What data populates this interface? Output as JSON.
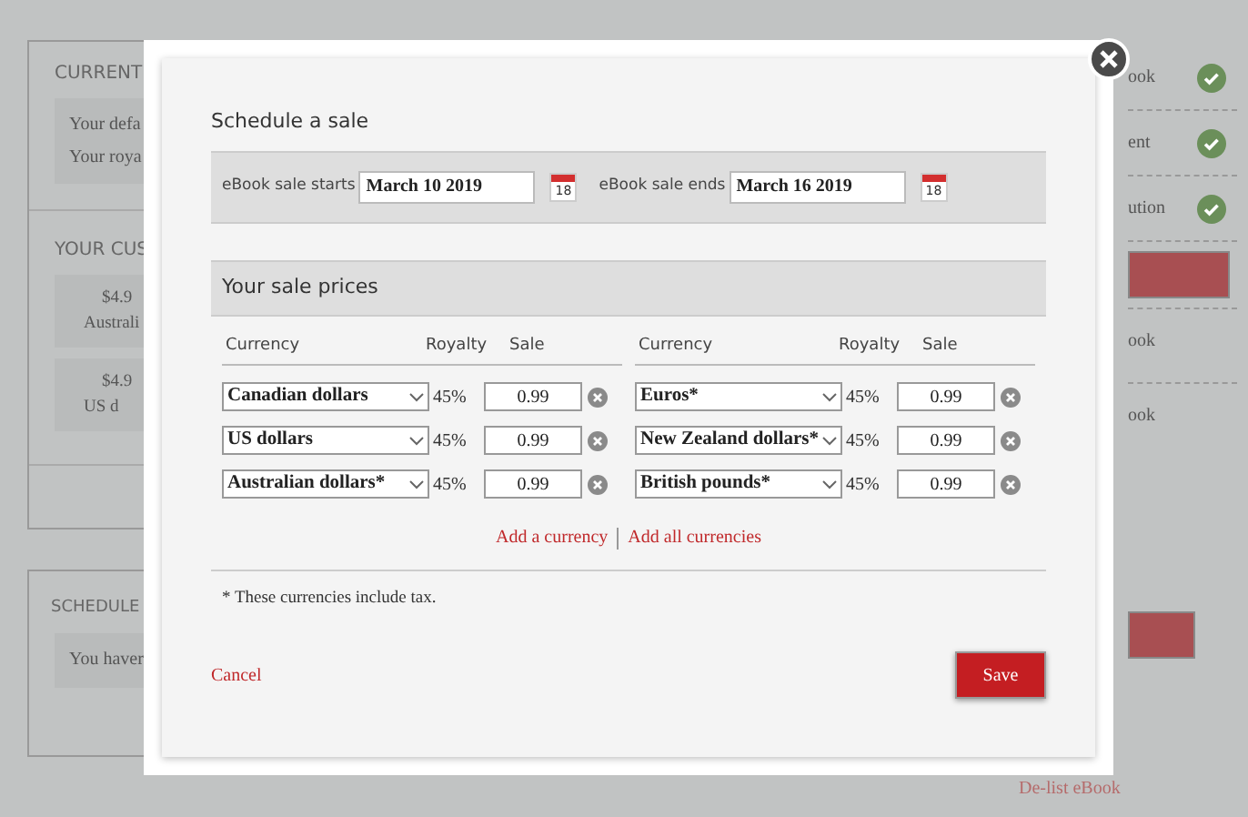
{
  "background": {
    "left_sections": [
      {
        "heading": "CURRENT",
        "lines": [
          "Your defa",
          "Your roya"
        ]
      },
      {
        "heading": "YOUR CUS",
        "cards": [
          [
            "$4.9",
            "Australi"
          ],
          [
            "$4.9",
            "US d"
          ]
        ]
      }
    ],
    "schedule_section": {
      "heading": "SCHEDULE",
      "text": "You haver"
    },
    "right_items": [
      {
        "label": "ook",
        "done": true
      },
      {
        "label": "ent",
        "done": true
      },
      {
        "label": "ution",
        "done": true
      }
    ],
    "right_links": [
      "ook",
      "ook"
    ],
    "delist": "De-list eBook"
  },
  "dialog": {
    "title": "Schedule a sale",
    "dates": [
      {
        "label": "eBook sale starts",
        "value": "March 10 2019",
        "calendar_day": "18"
      },
      {
        "label": "eBook sale ends",
        "value": "March 16 2019",
        "calendar_day": "18"
      }
    ],
    "prices_title": "Your sale prices",
    "price_tables": [
      {
        "columns": [
          "Currency",
          "Royalty",
          "Sale"
        ],
        "rows": [
          {
            "currency": "Canadian dollars",
            "royalty": "45%",
            "sale": "0.99"
          },
          {
            "currency": "US dollars",
            "royalty": "45%",
            "sale": "0.99"
          },
          {
            "currency": "Australian dollars*",
            "royalty": "45%",
            "sale": "0.99"
          }
        ]
      },
      {
        "columns": [
          "Currency",
          "Royalty",
          "Sale"
        ],
        "rows": [
          {
            "currency": "Euros*",
            "royalty": "45%",
            "sale": "0.99"
          },
          {
            "currency": "New Zealand dollars*",
            "royalty": "45%",
            "sale": "0.99"
          },
          {
            "currency": "British pounds*",
            "royalty": "45%",
            "sale": "0.99"
          }
        ]
      }
    ],
    "links": [
      "Add a currency",
      "Add all currencies"
    ],
    "footnote": "* These currencies include tax.",
    "cancel": "Cancel",
    "save": "Save"
  }
}
